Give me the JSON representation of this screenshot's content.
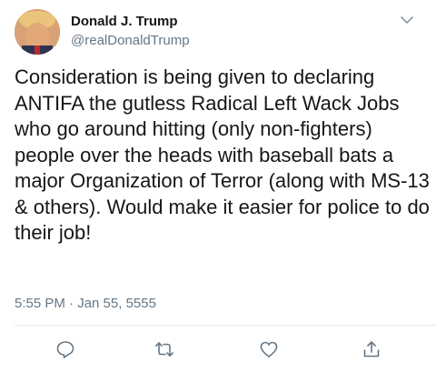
{
  "author": {
    "name": "Donald J. Trump",
    "handle": "@realDonaldTrump"
  },
  "tweet": {
    "text": "Consideration is being given to declaring ANTIFA the gutless Radical Left Wack Jobs who go around hitting (only non-fighters) people over the heads with baseball bats a major Organization of Terror (along with MS-13 & others). Would make it easier for police to do their job!",
    "timestamp": "5:55 PM · Jan 55, 5555"
  },
  "icons": {
    "menu": "chevron-down-icon",
    "reply": "reply-icon",
    "retweet": "retweet-icon",
    "like": "heart-icon",
    "share": "share-icon"
  },
  "colors": {
    "text": "#14171a",
    "secondary": "#657786",
    "divider": "#e1e8ed"
  }
}
